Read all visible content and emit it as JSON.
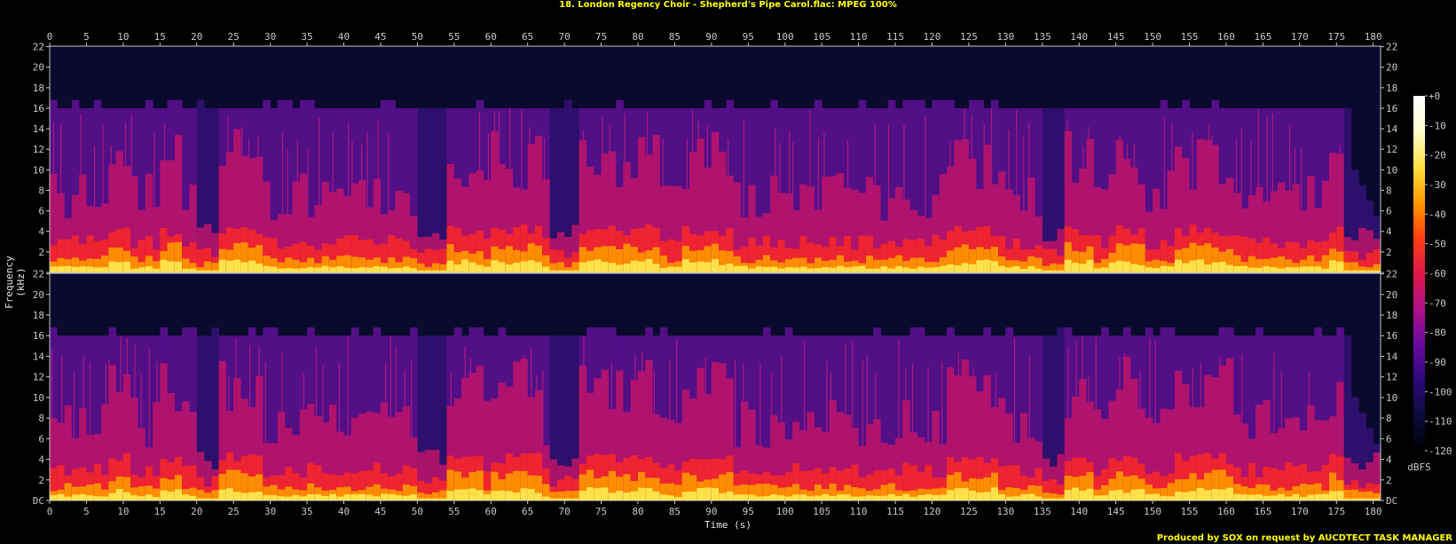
{
  "title": "18. London Regency Choir - Shepherd's Pipe Carol.flac: MPEG 100%",
  "footer": "Produced by SOX on request by AUCDTECT TASK MANAGER",
  "colors": {
    "title": "#ffff00",
    "footer": "#ffff00",
    "axis": "#c8c8c8",
    "background": "#000000"
  },
  "chart_data": {
    "type": "heatmap",
    "xlabel": "Time (s)",
    "ylabel": "Frequency (kHz)",
    "xlim": [
      0,
      181
    ],
    "ylim": [
      0,
      22.05
    ],
    "x_ticks": [
      0,
      5,
      10,
      15,
      20,
      25,
      30,
      35,
      40,
      45,
      50,
      55,
      60,
      65,
      70,
      75,
      80,
      85,
      90,
      95,
      100,
      105,
      110,
      115,
      120,
      125,
      130,
      135,
      140,
      145,
      150,
      155,
      160,
      165,
      170,
      175,
      180
    ],
    "y_ticks": [
      {
        "value": 0,
        "label": "DC"
      },
      {
        "value": 2,
        "label": "2"
      },
      {
        "value": 4,
        "label": "4"
      },
      {
        "value": 6,
        "label": "6"
      },
      {
        "value": 8,
        "label": "8"
      },
      {
        "value": 10,
        "label": "10"
      },
      {
        "value": 12,
        "label": "12"
      },
      {
        "value": 14,
        "label": "14"
      },
      {
        "value": 16,
        "label": "16"
      },
      {
        "value": 18,
        "label": "18"
      },
      {
        "value": 20,
        "label": "20"
      },
      {
        "value": 22,
        "label": "22"
      }
    ],
    "channels": 2,
    "lowpass_cutoff_khz": 16,
    "colorbar": {
      "label": "dBFS",
      "range": [
        -120,
        0
      ],
      "ticks": [
        {
          "value": 0,
          "label": "+0"
        },
        {
          "value": -10,
          "label": "-10"
        },
        {
          "value": -20,
          "label": "-20"
        },
        {
          "value": -30,
          "label": "-30"
        },
        {
          "value": -40,
          "label": "-40"
        },
        {
          "value": -50,
          "label": "-50"
        },
        {
          "value": -60,
          "label": "-60"
        },
        {
          "value": -70,
          "label": "-70"
        },
        {
          "value": -80,
          "label": "-80"
        },
        {
          "value": -90,
          "label": "-90"
        },
        {
          "value": -100,
          "label": "-100"
        },
        {
          "value": -110,
          "label": "-110"
        },
        {
          "value": -120,
          "label": "-120"
        }
      ]
    },
    "colormap": [
      "#000000",
      "#0c0c3c",
      "#2a0a7a",
      "#6a0aa0",
      "#b0108a",
      "#e01848",
      "#ff4010",
      "#ff9a00",
      "#ffe040",
      "#ffffd0",
      "#ffffff"
    ],
    "loud_sections_s": [
      [
        8,
        10
      ],
      [
        15,
        17
      ],
      [
        22,
        28
      ],
      [
        53,
        58
      ],
      [
        60,
        66
      ],
      [
        72,
        82
      ],
      [
        86,
        92
      ],
      [
        122,
        128
      ],
      [
        138,
        141
      ],
      [
        144,
        148
      ],
      [
        153,
        160
      ],
      [
        174,
        176
      ]
    ],
    "quiet_gaps_s": [
      [
        20,
        22
      ],
      [
        50,
        53
      ],
      [
        68,
        71
      ],
      [
        135,
        137
      ],
      [
        176,
        181
      ]
    ]
  }
}
